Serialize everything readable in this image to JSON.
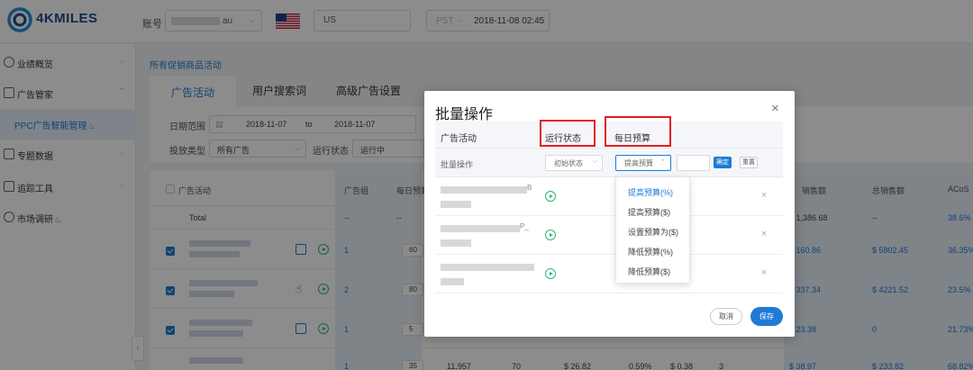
{
  "header": {
    "logo_text": "4KMILES",
    "account_label": "账号",
    "account_value_suffix": "au",
    "marketplace": "US",
    "timezone": "PST",
    "datetime": "2018-11-08 02:45"
  },
  "sidebar": {
    "items": [
      {
        "label": "业绩概览",
        "icon": "dashboard-icon"
      },
      {
        "label": "广告管家",
        "icon": "ad-manager-icon"
      },
      {
        "label": "专题数据",
        "icon": "data-icon"
      },
      {
        "label": "追踪工具",
        "icon": "tracking-icon"
      },
      {
        "label": "市场调研",
        "icon": "market-research-icon"
      }
    ],
    "active_subitem": "PPC广告智能管理"
  },
  "breadcrumb": "所有促销商品活动",
  "tabs": [
    "广告活动",
    "用户搜索词",
    "高级广告设置"
  ],
  "filters": {
    "date_range_label": "日期范围",
    "date_from": "2018-11-07",
    "to_label": "to",
    "date_to": "2018-11-07",
    "campaign_type_label": "投放类型",
    "campaign_type_value": "所有广告",
    "status_label": "运行状态",
    "status_value": "运行中"
  },
  "table": {
    "headers": {
      "campaign": "广告活动",
      "ad_group": "广告组",
      "daily_budget": "每日预算",
      "ad_sales": "销售额",
      "total_sales": "总销售额",
      "acos": "ACoS"
    },
    "total_row": {
      "label": "Total",
      "ad_group": "--",
      "budget": "--",
      "ad_sales": "$ 1,386.68",
      "total_sales": "--",
      "acos": "38.6%"
    },
    "rows": [
      {
        "ad_group": "1",
        "budget": "60",
        "ad_sales": "$ 160.86",
        "total_sales": "$ 5802.45",
        "acos": "36.35%"
      },
      {
        "ad_group": "2",
        "budget": "80",
        "ad_sales": "$ 337.34",
        "total_sales": "$ 4221.52",
        "acos": "23.5%"
      },
      {
        "ad_group": "1",
        "budget": "5",
        "ad_sales": "$ 23.38",
        "total_sales": "0",
        "acos": "21.73%"
      },
      {
        "ad_group": "1",
        "budget": "35",
        "impressions": "11,957",
        "clicks": "70",
        "spend": "$ 26.82",
        "ctr": "0.59%",
        "cpc": "$ 0.38",
        "orders": "3",
        "ad_sales": "$ 38.97",
        "total_sales": "$ 233.82",
        "acos": "68.82%"
      }
    ]
  },
  "modal": {
    "title": "批量操作",
    "close_glyph": "×",
    "col_campaign": "广告活动",
    "col_status": "运行状态",
    "col_budget": "每日预算",
    "bulk_label": "批量操作",
    "initial_status": "初始状态",
    "budget_action": "提高预算",
    "confirm": "确定",
    "reset": "重置",
    "rows": [
      {
        "suffix": "B"
      },
      {
        "suffix": "P_"
      },
      {
        "suffix": ""
      }
    ],
    "remove_glyph": "×",
    "cancel": "取消",
    "save": "保存"
  },
  "dropdown": {
    "options": [
      "提高预算(%)",
      "提高预算($)",
      "设置预算为($)",
      "降低预算(%)",
      "降低预算($)"
    ],
    "selected_index": 0
  },
  "colors": {
    "accent": "#1f7ad6",
    "highlight_box": "#e02020",
    "status_on": "#2bb673",
    "logo": "#1d4e89"
  }
}
